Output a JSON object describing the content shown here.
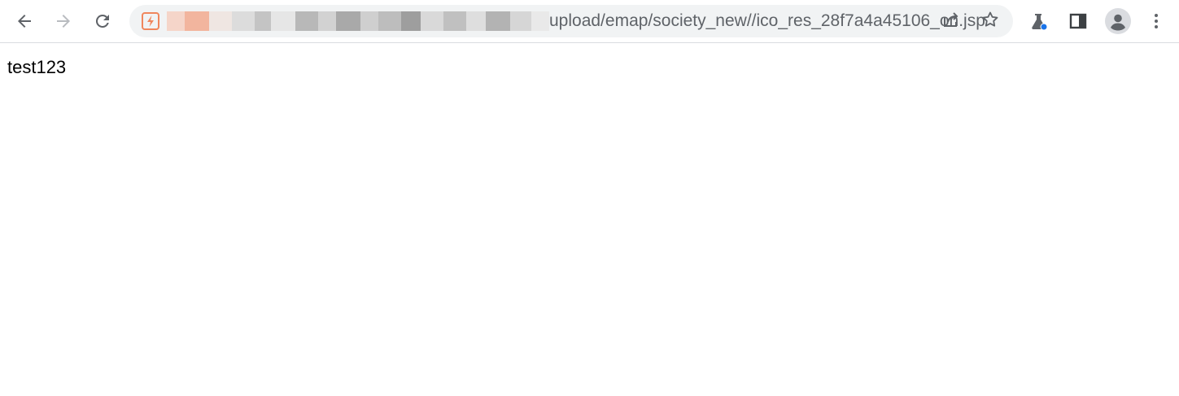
{
  "browser": {
    "address_bar": {
      "url_visible": "upload/emap/society_new//ico_res_28f7a4a45106_on.jsp",
      "url_obscured": true
    },
    "icons": {
      "back": "arrow-left-icon",
      "forward": "arrow-right-icon",
      "reload": "reload-icon",
      "site": "lightning-bolt-icon",
      "share": "share-icon",
      "bookmark": "star-icon",
      "labs": "flask-icon",
      "side_panel": "side-panel-icon",
      "profile": "profile-avatar-icon",
      "menu": "kebab-menu-icon"
    },
    "colors": {
      "toolbar_bg": "#ffffff",
      "omnibox_bg": "#f1f3f4",
      "icon_color": "#5f6368",
      "site_icon_color": "#f0865c",
      "labs_badge": "#1a73e8",
      "profile_bg": "#dadce0"
    }
  },
  "page": {
    "body_text": "test123"
  }
}
